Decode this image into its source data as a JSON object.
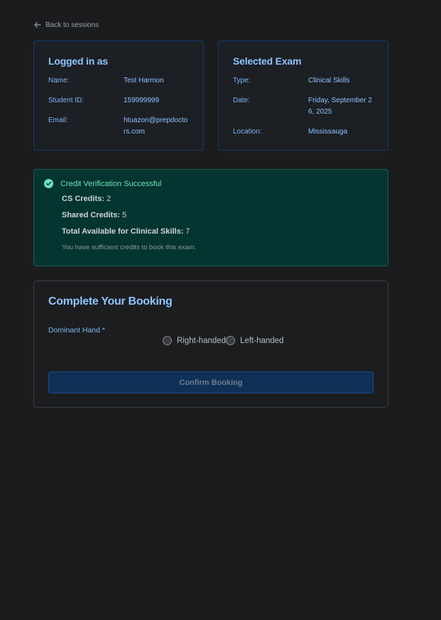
{
  "nav": {
    "back_label": "Back to sessions"
  },
  "user_card": {
    "title": "Logged in as",
    "rows": [
      {
        "label": "Name:",
        "value": "Test Harmon"
      },
      {
        "label": "Student ID:",
        "value": "159999999"
      },
      {
        "label": "Email:",
        "value": "htuazon@prepdoctors.com"
      }
    ]
  },
  "exam_card": {
    "title": "Selected Exam",
    "rows": [
      {
        "label": "Type:",
        "value": "Clinical Skills"
      },
      {
        "label": "Date:",
        "value": "Friday, September 26, 2025"
      },
      {
        "label": "Location:",
        "value": "Mississauga"
      }
    ]
  },
  "credits": {
    "heading": "Credit Verification Successful",
    "cs_label": "CS Credits:",
    "cs_value": "2",
    "shared_label": "Shared Credits:",
    "shared_value": "5",
    "total_label": "Total Available for Clinical Skills:",
    "total_value": "7",
    "note": "You have sufficient credits to book this exam."
  },
  "booking": {
    "title": "Complete Your Booking",
    "hand_label": "Dominant Hand *",
    "options": [
      "Right-handed",
      "Left-handed"
    ],
    "confirm_label": "Confirm Booking"
  },
  "colors": {
    "background": "#1b1c1d",
    "accent": "#8fc4ff",
    "success": "#6fe0b8",
    "success_bg": "#053530"
  }
}
